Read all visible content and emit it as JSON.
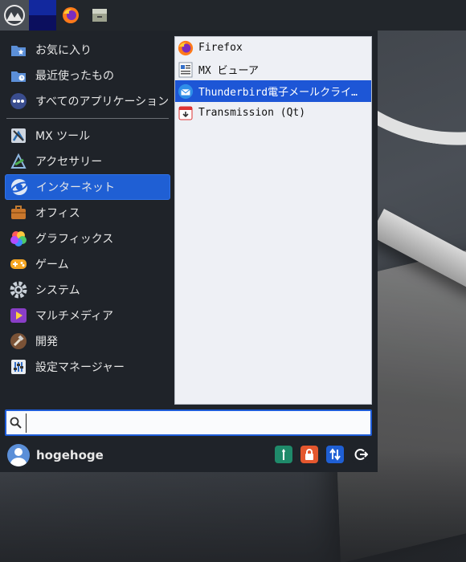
{
  "panel": {
    "menu_icon": "mx-menu-icon",
    "workspace_icon": "workspace-switcher",
    "launchers": [
      "firefox-icon",
      "file-manager-icon"
    ]
  },
  "categories": [
    {
      "label": "お気に入り",
      "icon": "favorites-icon"
    },
    {
      "label": "最近使ったもの",
      "icon": "recent-icon"
    },
    {
      "label": "すべてのアプリケーション",
      "icon": "all-apps-icon"
    },
    {
      "label": "MX ツール",
      "icon": "mx-tools-icon"
    },
    {
      "label": "アクセサリー",
      "icon": "accessories-icon"
    },
    {
      "label": "インターネット",
      "icon": "internet-icon"
    },
    {
      "label": "オフィス",
      "icon": "office-icon"
    },
    {
      "label": "グラフィックス",
      "icon": "graphics-icon"
    },
    {
      "label": "ゲーム",
      "icon": "games-icon"
    },
    {
      "label": "システム",
      "icon": "system-icon"
    },
    {
      "label": "マルチメディア",
      "icon": "multimedia-icon"
    },
    {
      "label": "開発",
      "icon": "development-icon"
    },
    {
      "label": "設定マネージャー",
      "icon": "settings-manager-icon"
    }
  ],
  "active_category": "インターネット",
  "apps": [
    {
      "label": "Firefox",
      "icon": "firefox-icon"
    },
    {
      "label": "MX ビューア",
      "icon": "mx-viewer-icon"
    },
    {
      "label": "Thunderbird電子メールクライ…",
      "icon": "thunderbird-icon"
    },
    {
      "label": "Transmission (Qt)",
      "icon": "transmission-icon"
    }
  ],
  "active_app": "Thunderbird電子メールクライ…",
  "search": {
    "value": "",
    "placeholder": ""
  },
  "user": {
    "name": "hogehoge"
  },
  "actions": [
    "settings-icon",
    "lock-screen-icon",
    "switch-user-icon",
    "logout-icon"
  ],
  "colors": {
    "accent": "#1f5fd4",
    "panel": "#22262b",
    "menu_bg": "#1f2329"
  }
}
